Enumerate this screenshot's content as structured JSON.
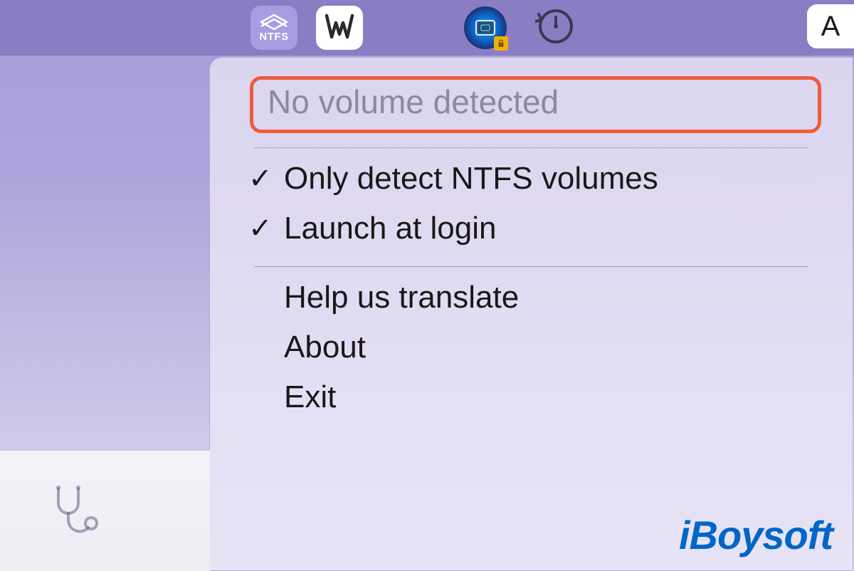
{
  "menubar": {
    "ntfs_label": "NTFS",
    "letter_tile": "A"
  },
  "dropdown": {
    "status": "No volume detected",
    "items": [
      {
        "checked": true,
        "label": "Only detect NTFS volumes"
      },
      {
        "checked": true,
        "label": "Launch at login"
      }
    ],
    "actions": [
      {
        "label": "Help us translate"
      },
      {
        "label": "About"
      },
      {
        "label": "Exit"
      }
    ]
  },
  "watermark": "iBoysoft"
}
